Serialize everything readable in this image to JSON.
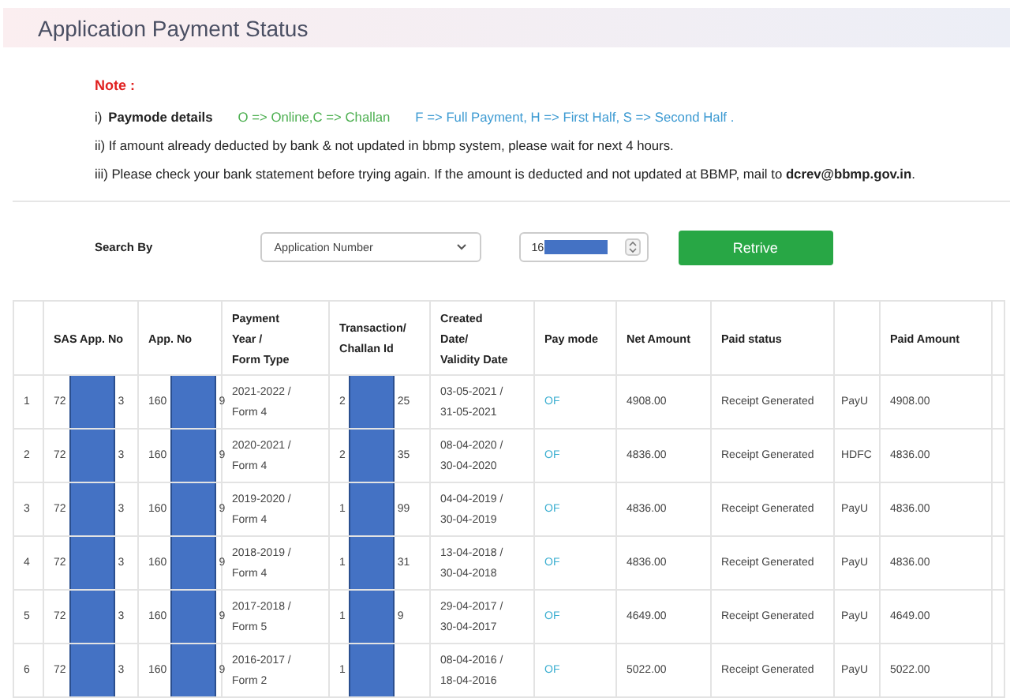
{
  "page_title": "Application Payment Status",
  "note": {
    "heading": "Note :",
    "paymode_line": {
      "number": "i)",
      "label": "Paymode details",
      "paymode_legend": "O => Online,C => Challan",
      "payment_legend": "F => Full Payment, H => First Half, S => Second Half ."
    },
    "lines": [
      "ii) If amount already deducted by bank & not updated in bbmp system, please wait for next 4 hours.",
      "iii) Please check your bank statement before trying again. If the amount is deducted and not updated at BBMP, mail to **dcrev@bbmp.gov.in**."
    ]
  },
  "search": {
    "label": "Search By",
    "select_value": "Application Number",
    "number_value": "16",
    "button": "Retrive"
  },
  "table": {
    "headers": {
      "sas_app_no": "SAS App. No",
      "app_no": "App. No",
      "year_form": "Payment\nYear /\nForm Type",
      "transaction": "Transaction/\nChallan Id",
      "dates": "Created\nDate/\nValidity Date",
      "pay_mode": "Pay mode",
      "net_amount": "Net Amount",
      "paid_status": "Paid status",
      "paid_amount": "Paid Amount"
    },
    "rows": [
      {
        "index": "1",
        "sas_app_no": [
          "72",
          "3"
        ],
        "app_no": [
          "160",
          "9"
        ],
        "year_form": "2021-2022 /\nForm 4",
        "transaction": [
          "2",
          "25"
        ],
        "dates": "03-05-2021 /\n31-05-2021",
        "pay_mode": "OF",
        "net_amount": "4908.00",
        "paid_status": "Receipt Generated",
        "column_10": "PayU",
        "paid_amount": "4908.00"
      },
      {
        "index": "2",
        "sas_app_no": [
          "72",
          "3"
        ],
        "app_no": [
          "160",
          "9"
        ],
        "year_form": "2020-2021 /\nForm 4",
        "transaction": [
          "2",
          "35"
        ],
        "dates": "08-04-2020 /\n30-04-2020",
        "pay_mode": "OF",
        "net_amount": "4836.00",
        "paid_status": "Receipt Generated",
        "column_10": "HDFC",
        "paid_amount": "4836.00"
      },
      {
        "index": "3",
        "sas_app_no": [
          "72",
          "3"
        ],
        "app_no": [
          "160",
          "9"
        ],
        "year_form": "2019-2020 /\nForm 4",
        "transaction": [
          "1",
          "99"
        ],
        "dates": "04-04-2019 /\n30-04-2019",
        "pay_mode": "OF",
        "net_amount": "4836.00",
        "paid_status": "Receipt Generated",
        "column_10": "PayU",
        "paid_amount": "4836.00"
      },
      {
        "index": "4",
        "sas_app_no": [
          "72",
          "3"
        ],
        "app_no": [
          "160",
          "9"
        ],
        "year_form": "2018-2019 /\nForm 4",
        "transaction": [
          "1",
          "31"
        ],
        "dates": "13-04-2018 /\n30-04-2018",
        "pay_mode": "OF",
        "net_amount": "4836.00",
        "paid_status": "Receipt Generated",
        "column_10": "PayU",
        "paid_amount": "4836.00"
      },
      {
        "index": "5",
        "sas_app_no": [
          "72",
          "3"
        ],
        "app_no": [
          "160",
          "9"
        ],
        "year_form": "2017-2018 /\nForm 5",
        "transaction": [
          "1",
          "9"
        ],
        "dates": "29-04-2017 /\n30-04-2017",
        "pay_mode": "OF",
        "net_amount": "4649.00",
        "paid_status": "Receipt Generated",
        "column_10": "PayU",
        "paid_amount": "4649.00"
      },
      {
        "index": "6",
        "sas_app_no": [
          "72",
          "3"
        ],
        "app_no": [
          "160",
          "9"
        ],
        "year_form": "2016-2017 /\nForm 2",
        "transaction": [
          "1"
        ],
        "dates": "08-04-2016 /\n18-04-2016",
        "pay_mode": "OF",
        "net_amount": "5022.00",
        "paid_status": "Receipt Generated",
        "column_10": "PayU",
        "paid_amount": "5022.00"
      }
    ]
  }
}
